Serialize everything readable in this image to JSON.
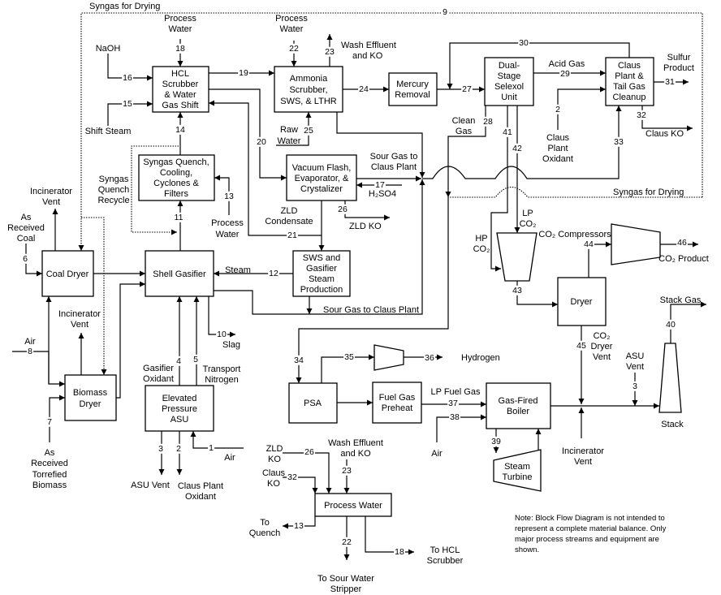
{
  "blocks": {
    "hcl": [
      "HCL",
      "Scrubber",
      "& Water",
      "Gas Shift"
    ],
    "ammonia": [
      "Ammonia",
      "Scrubber,",
      "SWS, & LTHR"
    ],
    "mercury": [
      "Mercury",
      "Removal"
    ],
    "selexol": [
      "Dual-",
      "Stage",
      "Selexol",
      "Unit"
    ],
    "claus": [
      "Claus",
      "Plant &",
      "Tail Gas",
      "Cleanup"
    ],
    "quench": [
      "Syngas Quench,",
      "Cooling,",
      "Cyclones &",
      "Filters"
    ],
    "vacuum": [
      "Vacuum Flash,",
      "Evaporator, &",
      "Crystalizer"
    ],
    "coal_dryer": [
      "Coal Dryer"
    ],
    "gasifier": [
      "Shell Gasifier"
    ],
    "sws": [
      "SWS and",
      "Gasifier",
      "Steam",
      "Production"
    ],
    "biomass_dryer": [
      "Biomass",
      "Dryer"
    ],
    "asu": [
      "Elevated",
      "Pressure",
      "ASU"
    ],
    "psa": [
      "PSA"
    ],
    "preheat": [
      "Fuel Gas",
      "Preheat"
    ],
    "boiler": [
      "Gas-Fired",
      "Boiler"
    ],
    "dryer": [
      "Dryer"
    ],
    "process_water": [
      "Process Water"
    ],
    "turbine": [
      "Steam",
      "Turbine"
    ],
    "stack": [
      "Stack"
    ]
  },
  "labels": {
    "syngas_drying_top": "Syngas for Drying",
    "syngas_drying_right": "Syngas for Drying",
    "process_water_18": [
      "Process",
      "Water"
    ],
    "process_water_22": [
      "Process",
      "Water"
    ],
    "process_water_13": [
      "Process",
      "Water"
    ],
    "naoh": "NaOH",
    "shift_steam": "Shift Steam",
    "wash_effluent": [
      "Wash Effluent",
      "and KO"
    ],
    "raw_water": [
      "Raw",
      "Water"
    ],
    "syngas_quench_recycle": [
      "Syngas",
      "Quench",
      "Recycle"
    ],
    "sour_gas_claus_1": [
      "Sour Gas to",
      "Claus Plant"
    ],
    "sour_gas_claus_2": "Sour Gas to Claus Plant",
    "h2so4": "H₂SO4",
    "zld_condensate": [
      "ZLD",
      "Condensate"
    ],
    "zld_ko_1": "ZLD KO",
    "clean_gas": [
      "Clean",
      "Gas"
    ],
    "acid_gas": "Acid Gas",
    "claus_plant_oxidant_top": [
      "Claus",
      "Plant",
      "Oxidant"
    ],
    "sulfur_product": [
      "Sulfur",
      "Product"
    ],
    "claus_ko_1": "Claus KO",
    "incinerator_vent_coal": [
      "Incinerator",
      "Vent"
    ],
    "as_received_coal": [
      "As",
      "Received",
      "Coal"
    ],
    "incinerator_vent_biomass": [
      "Incinerator",
      "Vent"
    ],
    "air_8": "Air",
    "torrefied_biomass": [
      "As",
      "Received",
      "Torrefied",
      "Biomass"
    ],
    "steam": "Steam",
    "slag": "Slag",
    "gasifier_oxidant": [
      "Gasifier",
      "Oxidant"
    ],
    "transport_nitrogen": [
      "Transport",
      "Nitrogen"
    ],
    "asu_vent_bottom": "ASU Vent",
    "claus_plant_oxidant_bottom": [
      "Claus Plant",
      "Oxidant"
    ],
    "air_1": "Air",
    "hp_co2": [
      "HP",
      "CO₂"
    ],
    "lp_co2": [
      "LP",
      "CO₂"
    ],
    "co2_compressors": "CO₂ Compressors",
    "co2_product": "CO₂ Product",
    "co2_dryer_vent": [
      "CO₂",
      "Dryer",
      "Vent"
    ],
    "asu_vent_right": [
      "ASU",
      "Vent"
    ],
    "stack_gas": "Stack Gas",
    "hydrogen": "Hydrogen",
    "lp_fuel_gas": "LP Fuel Gas",
    "air_38": "Air",
    "incinerator_vent_boiler": [
      "Incinerator",
      "Vent"
    ],
    "zld_ko_2": [
      "ZLD",
      "KO"
    ],
    "claus_ko_2": [
      "Claus",
      "KO"
    ],
    "wash_effluent_2": [
      "Wash Effluent",
      "and KO"
    ],
    "to_quench": [
      "To",
      "Quench"
    ],
    "to_sour_water": [
      "To Sour Water",
      "Stripper"
    ],
    "to_hcl": [
      "To HCL",
      "Scrubber"
    ]
  },
  "streams": {
    "s1": "1",
    "s2_asu": "2",
    "s2_claus": "2",
    "s3_asu": "3",
    "s3_stack": "3",
    "s4": "4",
    "s5": "5",
    "s6": "6",
    "s7": "7",
    "s8": "8",
    "s9": "9",
    "s10": "10",
    "s11": "11",
    "s12": "12",
    "s13_quench": "13",
    "s13_pw": "13",
    "s14": "14",
    "s15": "15",
    "s16": "16",
    "s17": "17",
    "s18_hcl": "18",
    "s18_pw": "18",
    "s19": "19",
    "s20": "20",
    "s21": "21",
    "s22_amm": "22",
    "s22_pw": "22",
    "s23_amm": "23",
    "s23_pw": "23",
    "s24": "24",
    "s25": "25",
    "s26_vac": "26",
    "s26_pw": "26",
    "s27": "27",
    "s28": "28",
    "s29": "29",
    "s30": "30",
    "s31": "31",
    "s32_claus": "32",
    "s32_pw": "32",
    "s33": "33",
    "s34": "34",
    "s35": "35",
    "s36": "36",
    "s37": "37",
    "s38": "38",
    "s39": "39",
    "s40": "40",
    "s41": "41",
    "s42": "42",
    "s43": "43",
    "s44": "44",
    "s45": "45",
    "s46": "46"
  },
  "note": [
    "Note:  Block Flow Diagram is not intended to",
    "represent a complete material balance.  Only",
    "major process streams and equipment are",
    "shown."
  ]
}
